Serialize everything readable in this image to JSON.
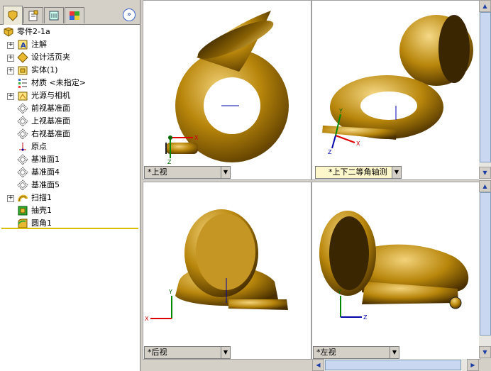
{
  "tree": {
    "root": "零件2-1a",
    "items": [
      {
        "label": "注解",
        "icon": "annotation-icon",
        "expandable": true
      },
      {
        "label": "设计活页夹",
        "icon": "design-binder-icon",
        "expandable": true
      },
      {
        "label": "实体(1)",
        "icon": "solid-bodies-icon",
        "expandable": true
      },
      {
        "label": "材质 <未指定>",
        "icon": "material-icon",
        "expandable": false
      },
      {
        "label": "光源与相机",
        "icon": "lights-cameras-icon",
        "expandable": true
      },
      {
        "label": "前视基准面",
        "icon": "plane-icon",
        "expandable": false
      },
      {
        "label": "上视基准面",
        "icon": "plane-icon",
        "expandable": false
      },
      {
        "label": "右视基准面",
        "icon": "plane-icon",
        "expandable": false
      },
      {
        "label": "原点",
        "icon": "origin-icon",
        "expandable": false
      },
      {
        "label": "基准面1",
        "icon": "plane-icon",
        "expandable": false
      },
      {
        "label": "基准面4",
        "icon": "plane-icon",
        "expandable": false
      },
      {
        "label": "基准面5",
        "icon": "plane-icon",
        "expandable": false
      },
      {
        "label": "扫描1",
        "icon": "sweep-icon",
        "expandable": true
      },
      {
        "label": "抽壳1",
        "icon": "shell-icon",
        "expandable": false
      },
      {
        "label": "圆角1",
        "icon": "fillet-icon",
        "expandable": false
      }
    ]
  },
  "viewports": {
    "top_left": "*上视",
    "top_right": "*上下二等角轴测",
    "bottom_left": "*后视",
    "bottom_right": "*左视"
  },
  "axes": {
    "x": "X",
    "y": "Y",
    "z": "Z"
  },
  "colors": {
    "brass": "#b8860b",
    "brass_light": "#e6c15a",
    "brass_dark": "#5c3d00",
    "selection": "#d8c000"
  }
}
